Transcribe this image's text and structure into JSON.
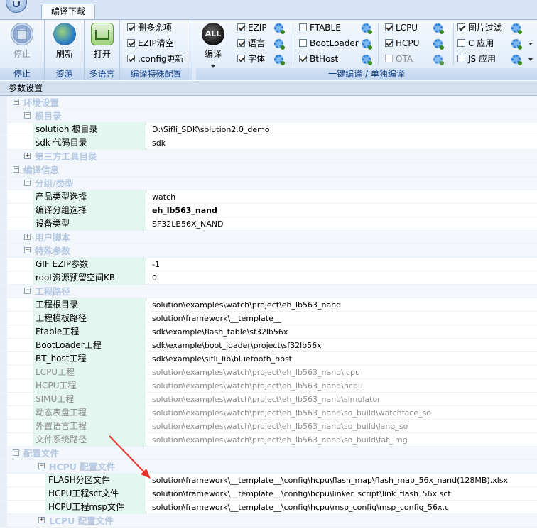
{
  "ribbon": {
    "tab": "编译下载",
    "groups": {
      "stop": {
        "button": "停止",
        "label": "停止"
      },
      "resource": {
        "button": "刷新",
        "label": "资源"
      },
      "language": {
        "button": "打开",
        "label": "多语言"
      },
      "special": {
        "label": "编译特殊配置",
        "options": [
          {
            "text": "删多余项",
            "checked": true
          },
          {
            "text": "EZIP清空",
            "checked": true
          },
          {
            "text": ".config更新",
            "checked": true
          }
        ]
      },
      "compile": {
        "button": "编译",
        "all_icon_text": "ALL",
        "label": "一键编译 / 单独编译",
        "col1": [
          {
            "text": "EZIP",
            "checked": true
          },
          {
            "text": "语言",
            "checked": true
          },
          {
            "text": "字体",
            "checked": true
          }
        ],
        "col2": [
          {
            "text": "FTABLE",
            "checked": false
          },
          {
            "text": "BootLoader",
            "checked": false
          },
          {
            "text": "BtHost",
            "checked": true
          }
        ],
        "col3": [
          {
            "text": "LCPU",
            "checked": true
          },
          {
            "text": "HCPU",
            "checked": true
          },
          {
            "text": "OTA",
            "checked": false,
            "dim": true
          }
        ],
        "col4": [
          {
            "text": "图片过滤",
            "checked": true
          },
          {
            "text": "C 应用",
            "checked": false
          },
          {
            "text": "JS 应用",
            "checked": false
          }
        ]
      }
    }
  },
  "grid": {
    "header": "参数设置",
    "rows": [
      {
        "kind": "cat",
        "level": 0,
        "toggle": "−",
        "text": "环境设置"
      },
      {
        "kind": "cat",
        "level": 1,
        "toggle": "−",
        "text": "根目录"
      },
      {
        "kind": "prop",
        "level": 1,
        "name": "solution 根目录",
        "value": "D:\\Sifli_SDK\\solution2.0_demo"
      },
      {
        "kind": "prop",
        "level": 1,
        "name": "sdk 代码目录",
        "value": "sdk"
      },
      {
        "kind": "cat",
        "level": 1,
        "toggle": "+",
        "text": "第三方工具目录"
      },
      {
        "kind": "cat",
        "level": 0,
        "toggle": "−",
        "text": "编译信息"
      },
      {
        "kind": "cat",
        "level": 1,
        "toggle": "−",
        "text": "分组/类型"
      },
      {
        "kind": "prop",
        "level": 1,
        "name": "产品类型选择",
        "value": "watch"
      },
      {
        "kind": "prop",
        "level": 1,
        "name": "编译分组选择",
        "value": "eh_lb563_nand",
        "bold": true
      },
      {
        "kind": "prop",
        "level": 1,
        "name": "设备类型",
        "value": "SF32LB56X_NAND"
      },
      {
        "kind": "cat",
        "level": 1,
        "toggle": "+",
        "text": "用户脚本"
      },
      {
        "kind": "cat",
        "level": 1,
        "toggle": "−",
        "text": "特殊参数"
      },
      {
        "kind": "prop",
        "level": 1,
        "name": "GIF EZIP参数",
        "value": "-1"
      },
      {
        "kind": "prop",
        "level": 1,
        "name": "root资源预留空间KB",
        "value": "0"
      },
      {
        "kind": "cat",
        "level": 1,
        "toggle": "−",
        "text": "工程路径"
      },
      {
        "kind": "prop",
        "level": 1,
        "name": "工程根目录",
        "value": "solution\\examples\\watch\\project\\eh_lb563_nand"
      },
      {
        "kind": "prop",
        "level": 1,
        "name": "工程模板路径",
        "value": "solution\\framework\\__template__"
      },
      {
        "kind": "prop",
        "level": 1,
        "name": "Ftable工程",
        "value": "sdk\\example\\flash_table\\sf32lb56x"
      },
      {
        "kind": "prop",
        "level": 1,
        "name": "BootLoader工程",
        "value": "sdk\\example\\boot_loader\\project\\sf32lb56x"
      },
      {
        "kind": "prop",
        "level": 1,
        "name": "BT_host工程",
        "value": "sdk\\example\\sifli_lib\\bluetooth_host"
      },
      {
        "kind": "prop",
        "level": 1,
        "name": "LCPU工程",
        "value": "solution\\examples\\watch\\project\\eh_lb563_nand\\lcpu",
        "dim": true
      },
      {
        "kind": "prop",
        "level": 1,
        "name": "HCPU工程",
        "value": "solution\\examples\\watch\\project\\eh_lb563_nand\\hcpu",
        "dim": true
      },
      {
        "kind": "prop",
        "level": 1,
        "name": "SIMU工程",
        "value": "solution\\examples\\watch\\project\\eh_lb563_nand\\simulator",
        "dim": true
      },
      {
        "kind": "prop",
        "level": 1,
        "name": "动态表盘工程",
        "value": "solution\\examples\\watch\\project\\eh_lb563_nand\\so_build\\watchface_so",
        "dim": true
      },
      {
        "kind": "prop",
        "level": 1,
        "name": "外置语言工程",
        "value": "solution\\examples\\watch\\project\\eh_lb563_nand\\so_build\\lang_so",
        "dim": true
      },
      {
        "kind": "prop",
        "level": 1,
        "name": "文件系统路径",
        "value": "solution\\examples\\watch\\project\\eh_lb563_nand\\so_build\\fat_img",
        "dim": true
      },
      {
        "kind": "cat",
        "level": 0,
        "toggle": "−",
        "text": "配置文件"
      },
      {
        "kind": "cat",
        "level": 2,
        "toggle": "−",
        "text": "HCPU 配置文件"
      },
      {
        "kind": "prop",
        "level": 2,
        "name": "FLASH分区文件",
        "value": "solution\\framework\\__template__\\config\\hcpu\\flash_map\\flash_map_56x_nand(128MB).xlsx"
      },
      {
        "kind": "prop",
        "level": 2,
        "name": "HCPU工程sct文件",
        "value": "solution\\framework\\__template__\\config\\hcpu\\linker_script\\link_flash_56x.sct"
      },
      {
        "kind": "prop",
        "level": 2,
        "name": "HCPU工程msp文件",
        "value": "solution\\framework\\__template__\\config\\hcpu\\msp_config\\msp_config_56x.c"
      },
      {
        "kind": "cat",
        "level": 2,
        "toggle": "+",
        "text": "LCPU 配置文件"
      }
    ]
  },
  "annotation": {
    "color": "#e8322a"
  }
}
